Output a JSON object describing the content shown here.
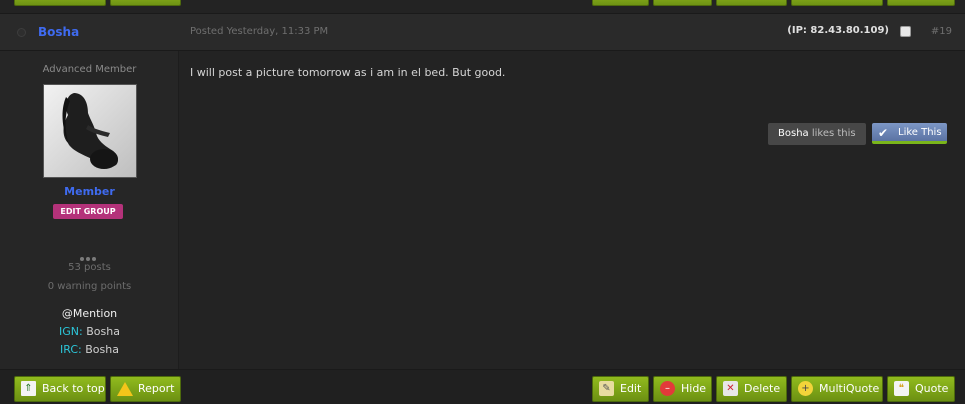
{
  "post": {
    "author": "Bosha",
    "posted": "Posted Yesterday, 11:33 PM",
    "ip": "(IP: 82.43.80.109)",
    "number": "#19",
    "body": "I will post a picture tomorrow as i am in el bed. But good."
  },
  "author_info": {
    "title": "Advanced Member",
    "group": "Member",
    "edit_group_label": "EDIT GROUP",
    "posts": "53 posts",
    "warnings": "0 warning points",
    "mention": "@Mention",
    "fields": [
      {
        "key": "IGN:",
        "value": "Bosha"
      },
      {
        "key": "IRC:",
        "value": "Bosha"
      }
    ]
  },
  "likes": {
    "who": "Bosha",
    "suffix": "likes this",
    "like_button": "Like This"
  },
  "footer": {
    "back_to_top": "Back to top",
    "report": "Report",
    "edit": "Edit",
    "hide": "Hide",
    "delete": "Delete",
    "multiquote": "MultiQuote",
    "quote": "Quote"
  },
  "colors": {
    "author_link": "#3f6bf0",
    "button_green": "#7fa619",
    "edit_group_badge": "#b4327a",
    "like_button": "#6b84b5"
  }
}
